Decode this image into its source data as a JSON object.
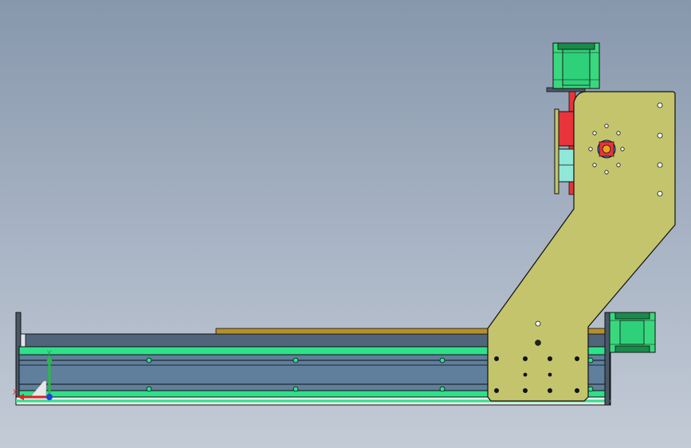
{
  "viewport": {
    "background_top": "#8797ac",
    "background_bottom": "#c3cbd6"
  },
  "colors": {
    "gantry_plate": "#c3c46c",
    "motor_body": "#3ad87e",
    "motor_dark": "#1a8a4a",
    "rail_green": "#2fe08a",
    "tube_blue": "#5f7f9c",
    "leadscrew_red": "#e8343a",
    "bearing_cyan": "#8fe8d8",
    "table_strip": "#b5902a",
    "hole_fill": "#2fd07a"
  },
  "triad": {
    "x_label": "X",
    "y_label": "Y",
    "x_color": "#e02020",
    "y_color": "#20c040",
    "z_color": "#2040e0"
  }
}
